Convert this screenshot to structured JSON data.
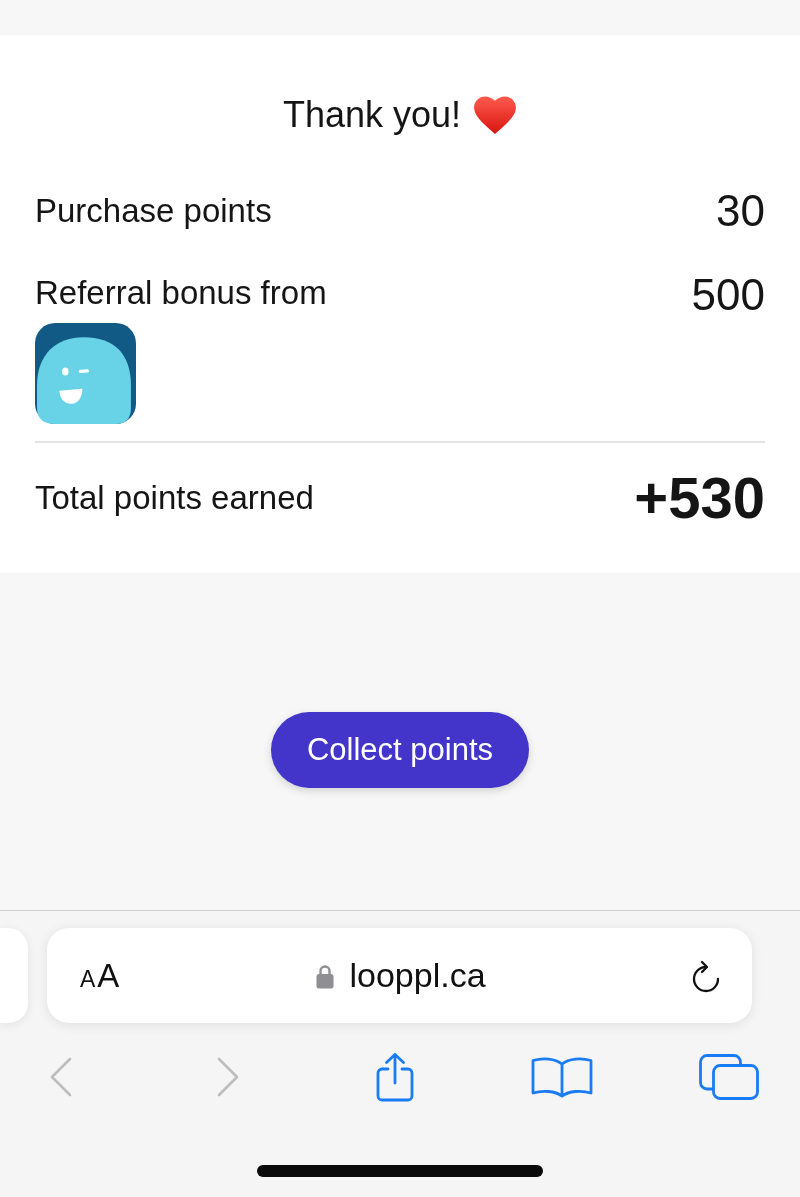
{
  "header": {
    "title": "Thank you!"
  },
  "points": [
    {
      "kind": "purchase",
      "label": "Purchase points",
      "value": "30"
    },
    {
      "kind": "referral",
      "label": "Referral bonus from",
      "value": "500"
    }
  ],
  "total": {
    "label": "Total points earned",
    "value": "+530"
  },
  "collect_button": {
    "label": "Collect points"
  },
  "browser": {
    "text_size_button": {
      "small_letter": "A",
      "large_letter": "A"
    },
    "url": "looppl.ca",
    "toolbar": [
      {
        "kind": "back",
        "disabled": true
      },
      {
        "kind": "forward",
        "disabled": true
      },
      {
        "kind": "share",
        "disabled": false
      },
      {
        "kind": "bookmarks",
        "disabled": false
      },
      {
        "kind": "tabs",
        "disabled": false
      }
    ]
  }
}
